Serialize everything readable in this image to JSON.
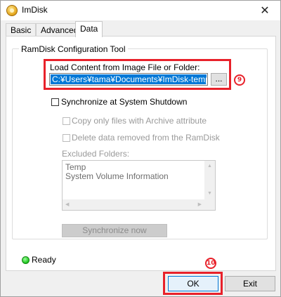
{
  "window": {
    "title": "ImDisk",
    "close_glyph": "✕"
  },
  "tabs": [
    {
      "label": "Basic"
    },
    {
      "label": "Advanced"
    },
    {
      "label": "Data",
      "active": true
    }
  ],
  "group": {
    "title": "RamDisk Configuration Tool"
  },
  "load": {
    "label": "Load Content from Image File or Folder:",
    "value": "C:¥Users¥tama¥Documents¥ImDisk-temp",
    "browse_label": "...",
    "badge": "9"
  },
  "sync": {
    "label": "Synchronize at System Shutdown",
    "checked": false,
    "copy_archive_label": "Copy only files with Archive attribute",
    "delete_removed_label": "Delete data removed from the RamDisk",
    "excluded_label": "Excluded Folders:",
    "excluded_folders": [
      "Temp",
      "System Volume Information"
    ],
    "sync_now_label": "Synchronize now"
  },
  "status": {
    "text": "Ready",
    "color": "#19c319"
  },
  "footer": {
    "ok_label": "OK",
    "exit_label": "Exit",
    "badge": "10"
  },
  "colors": {
    "highlight": "#e8212a",
    "selection": "#0078d7"
  },
  "icons": {
    "app": "imdisk-app-icon",
    "close": "close-icon",
    "status": "green-status-icon"
  }
}
